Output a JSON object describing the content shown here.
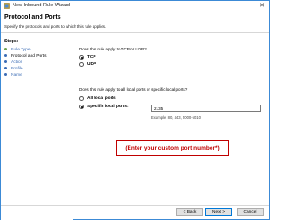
{
  "window": {
    "title": "New Inbound Rule Wizard",
    "close_glyph": "✕"
  },
  "header": {
    "title": "Protocol and Ports",
    "subtitle": "Specify the protocols and ports to which this rule applies."
  },
  "sidebar": {
    "title": "Steps:",
    "items": [
      {
        "label": "Rule Type",
        "state": "done"
      },
      {
        "label": "Protocol and Ports",
        "state": "current"
      },
      {
        "label": "Action",
        "state": "todo"
      },
      {
        "label": "Profile",
        "state": "todo"
      },
      {
        "label": "Name",
        "state": "todo"
      }
    ]
  },
  "protocol": {
    "question": "Does this rule apply to TCP or UDP?",
    "options": [
      {
        "label": "TCP",
        "selected": true
      },
      {
        "label": "UDP",
        "selected": false
      }
    ]
  },
  "ports": {
    "question": "Does this rule apply to all local ports or specific local ports?",
    "options": [
      {
        "label": "All local ports",
        "selected": false
      },
      {
        "label": "Specific local ports:",
        "selected": true
      }
    ],
    "value": "2135",
    "example": "Example: 80, 443, 5000-5010"
  },
  "annotation": {
    "text": "(Enter your custom port number*)",
    "color": "#c00000"
  },
  "footer": {
    "back_label": "< Back",
    "next_label": "Next >",
    "cancel_label": "Cancel"
  }
}
